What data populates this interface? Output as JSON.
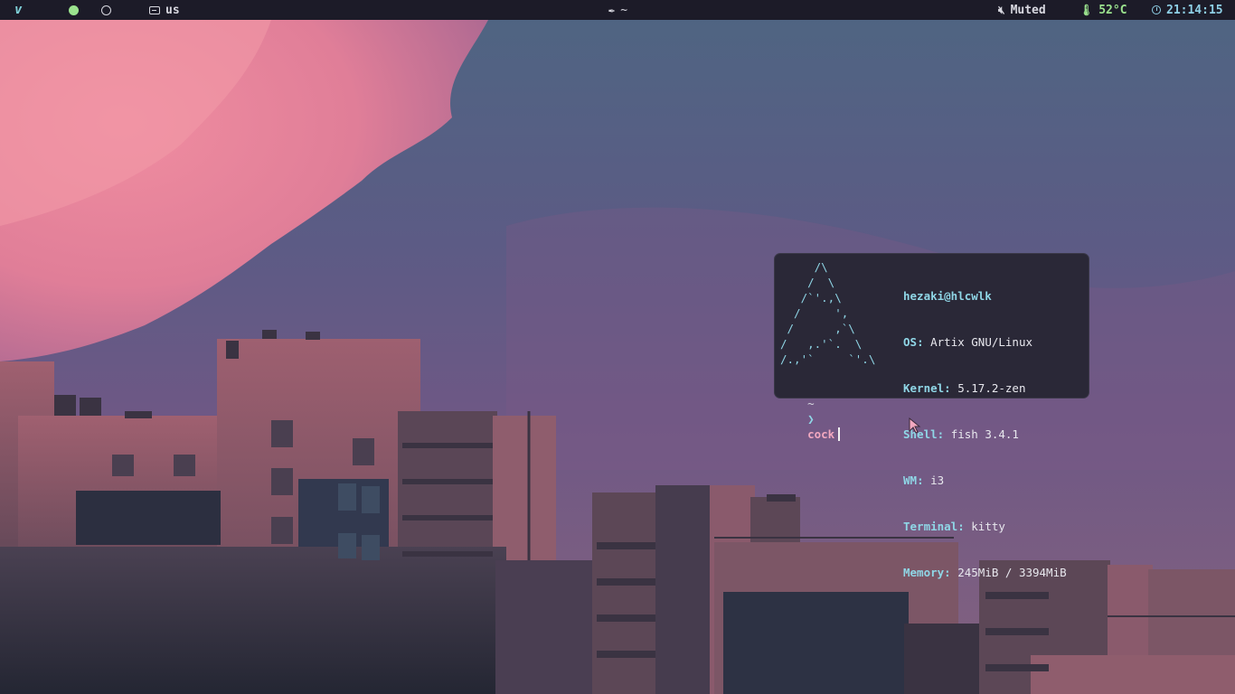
{
  "topbar": {
    "logo": "v",
    "layout": "us",
    "center": "~",
    "volume": "Muted",
    "temperature": "52°C",
    "time": "21:14:15"
  },
  "terminal": {
    "ascii_art": "     /\\\n    /  \\\n   /`'.,\\\n  /     ',\n /      ,`\\\n/   ,.'`.  \\\n/.,'`     `'.\\",
    "host": "hezaki@hlcwlk",
    "info": [
      {
        "key": "OS",
        "value": "Artix GNU/Linux"
      },
      {
        "key": "Kernel",
        "value": "5.17.2-zen"
      },
      {
        "key": "Shell",
        "value": "fish 3.4.1"
      },
      {
        "key": "WM",
        "value": "i3"
      },
      {
        "key": "Terminal",
        "value": "kitty"
      },
      {
        "key": "Memory",
        "value": "245MiB / 3394MiB"
      }
    ],
    "prompt": {
      "tilde": "~",
      "arrow": "❯",
      "command": "cock"
    }
  },
  "colors": {
    "bar_bg": "#1c1b28",
    "accent_cyan": "#8fd6e6",
    "accent_green": "#9be38e",
    "accent_pink": "#f2a8c0",
    "terminal_bg": "#2a2837"
  }
}
